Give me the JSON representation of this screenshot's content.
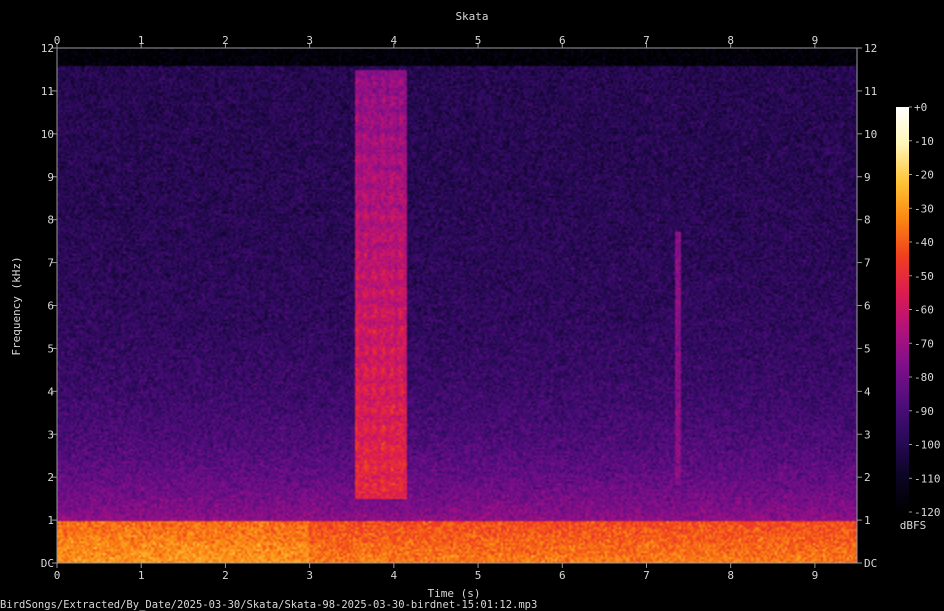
{
  "chart_data": {
    "type": "heatmap",
    "title": "Skata",
    "xlabel": "Time (s)",
    "ylabel": "Frequency (kHz)",
    "xlim": [
      0,
      9.5
    ],
    "ylim": [
      0,
      12
    ],
    "x_ticks": [
      "0",
      "1",
      "2",
      "3",
      "4",
      "5",
      "6",
      "7",
      "8",
      "9"
    ],
    "y_ticks": [
      "DC",
      "1",
      "2",
      "3",
      "4",
      "5",
      "6",
      "7",
      "8",
      "9",
      "10",
      "11",
      "12"
    ],
    "colorbar": {
      "label": "dBFS",
      "range": [
        -120,
        0
      ],
      "ticks": [
        "+0",
        "-10",
        "-20",
        "-30",
        "-40",
        "-50",
        "-60",
        "-70",
        "-80",
        "-90",
        "-100",
        "-110",
        "-120"
      ]
    },
    "colormap": [
      "#000000",
      "#0c0525",
      "#2a0a5a",
      "#510d7d",
      "#7f0f8a",
      "#b3127a",
      "#de1c4f",
      "#f1421d",
      "#fb8a12",
      "#ffc63a",
      "#fff6b8",
      "#ffffff"
    ],
    "features": [
      {
        "label": "broadband harmonic call",
        "t_range": [
          3.55,
          4.15
        ],
        "f_range": [
          1.5,
          11.5
        ],
        "level_db": -55
      },
      {
        "label": "low-frequency noise band",
        "t_range": [
          0,
          9.5
        ],
        "f_range": [
          0,
          1.0
        ],
        "level_db": -35
      },
      {
        "label": "transient",
        "t_range": [
          7.35,
          7.4
        ],
        "f_range": [
          1.8,
          7.7
        ],
        "level_db": -75
      }
    ]
  },
  "footer": {
    "file_path": "BirdSongs/Extracted/By_Date/2025-03-30/Skata/Skata-98-2025-03-30-birdnet-15:01:12.mp3"
  }
}
